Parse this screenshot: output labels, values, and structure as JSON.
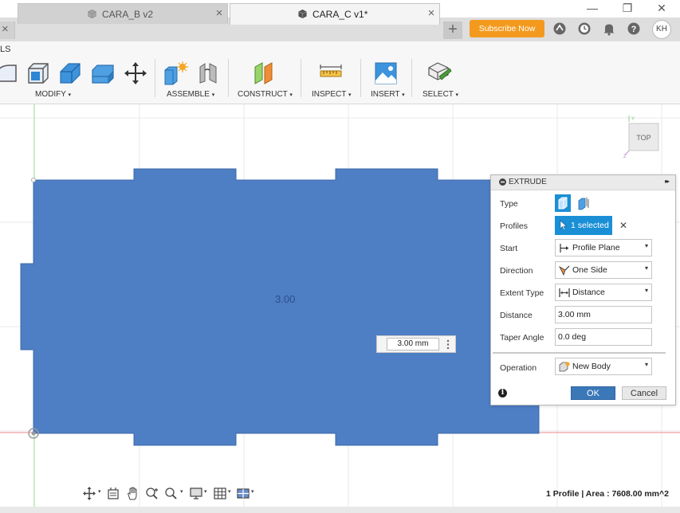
{
  "titlebar": {
    "minimize": "—",
    "restore": "❐",
    "close": "✕"
  },
  "tabs": [
    {
      "label": "CARA_B v2",
      "active": false
    },
    {
      "label": "CARA_C v1*",
      "active": true
    }
  ],
  "header": {
    "subscribe_label": "Subscribe Now",
    "avatar_initials": "KH",
    "new_tab": "+",
    "tab_close": "×",
    "left_tab_close": "×"
  },
  "toolbar": {
    "partial_label": "LS",
    "groups": [
      {
        "label": "MODIFY"
      },
      {
        "label": "ASSEMBLE"
      },
      {
        "label": "CONSTRUCT"
      },
      {
        "label": "INSPECT"
      },
      {
        "label": "INSERT"
      },
      {
        "label": "SELECT"
      }
    ],
    "caret": "▾"
  },
  "viewcube": {
    "label": "TOP",
    "axis_z": "Z",
    "axis_y": "Y"
  },
  "canvas": {
    "dimension_label": "3.00",
    "distance_input": "3.00 mm",
    "body_color": "#4e7ec4"
  },
  "dialog": {
    "title": "EXTRUDE",
    "expand_glyph": "▸▸",
    "rows": {
      "type": "Type",
      "profiles": "Profiles",
      "profiles_value": "1 selected",
      "profiles_clear": "✕",
      "start": "Start",
      "start_value": "Profile Plane",
      "direction": "Direction",
      "direction_value": "One Side",
      "extent_type": "Extent Type",
      "extent_value": "Distance",
      "distance": "Distance",
      "distance_value": "3.00 mm",
      "taper_angle": "Taper Angle",
      "taper_value": "0.0 deg",
      "operation": "Operation",
      "operation_value": "New Body"
    },
    "info_glyph": "i",
    "ok_label": "OK",
    "cancel_label": "Cancel",
    "accent": "#1a8fd6"
  },
  "statusbar": {
    "text": "1 Profile | Area : 7608.00 mm^2"
  }
}
